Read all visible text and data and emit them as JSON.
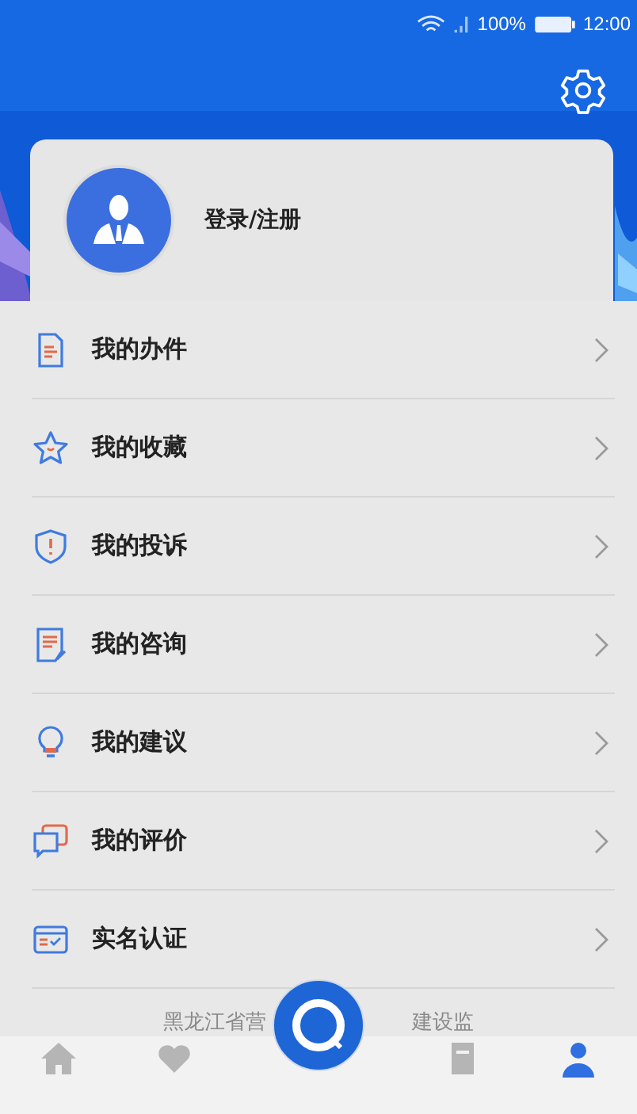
{
  "status_bar": {
    "battery": "100%",
    "time": "12:00"
  },
  "profile": {
    "login_label": "登录/注册"
  },
  "menu": [
    {
      "kind": "document",
      "label": "我的办件"
    },
    {
      "kind": "star",
      "label": "我的收藏"
    },
    {
      "kind": "shield",
      "label": "我的投诉"
    },
    {
      "kind": "note",
      "label": "我的咨询"
    },
    {
      "kind": "bulb",
      "label": "我的建议"
    },
    {
      "kind": "chat",
      "label": "我的评价"
    },
    {
      "kind": "card",
      "label": "实名认证"
    }
  ],
  "footer": {
    "text_left": "黑龙江省营",
    "text_right": "建设监"
  },
  "bottom_nav": [
    {
      "kind": "home",
      "selected": false
    },
    {
      "kind": "heart",
      "selected": false
    },
    {
      "kind": "center",
      "selected": false
    },
    {
      "kind": "doc",
      "selected": false
    },
    {
      "kind": "person",
      "selected": true
    }
  ]
}
